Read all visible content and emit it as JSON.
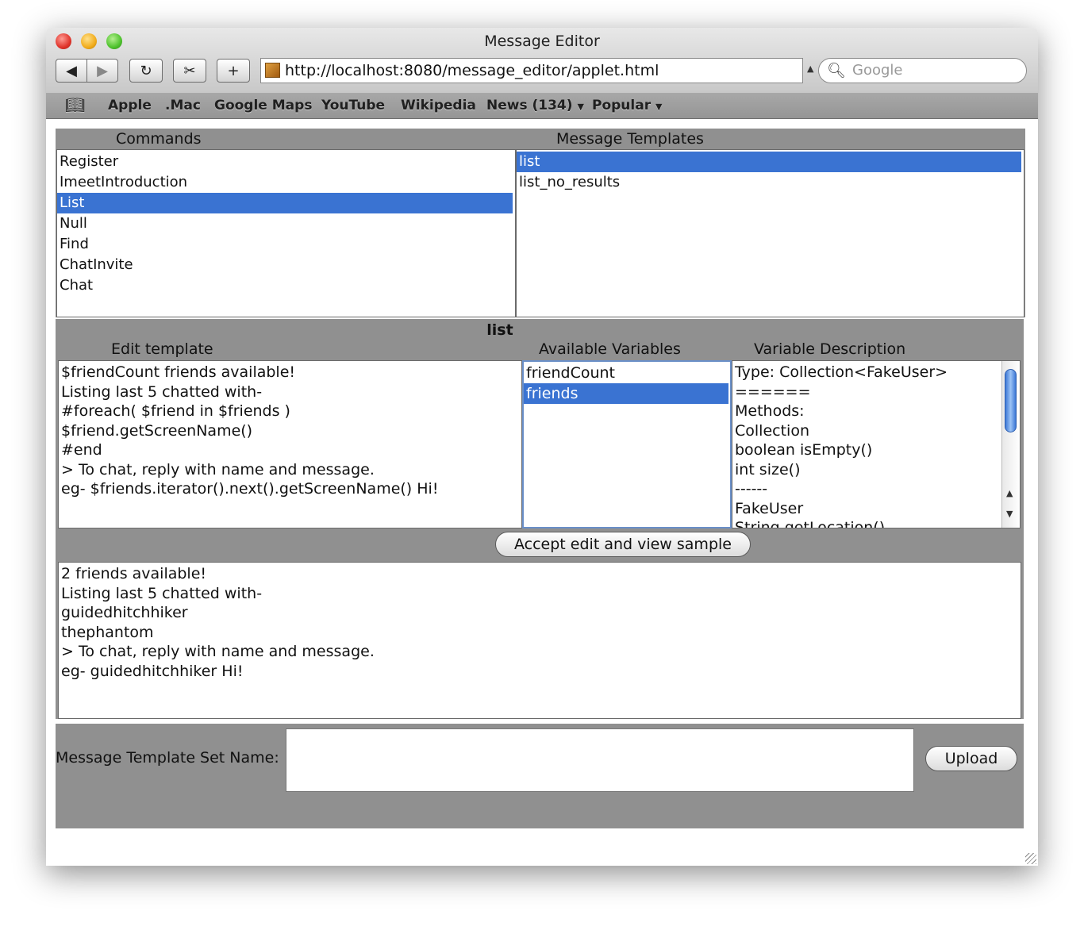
{
  "window": {
    "title": "Message Editor"
  },
  "toolbar": {
    "url": "http://localhost:8080/message_editor/applet.html",
    "search_placeholder": "Google"
  },
  "bookmarks": [
    "Apple",
    ".Mac",
    "Google Maps",
    "YouTube",
    "Wikipedia",
    "News (134)",
    "Popular"
  ],
  "commands": {
    "header": "Commands",
    "items": [
      "Register",
      "ImeetIntroduction",
      "List",
      "Null",
      "Find",
      "ChatInvite",
      "Chat"
    ],
    "selected": "List"
  },
  "templates": {
    "header": "Message Templates",
    "items": [
      "list",
      "list_no_results"
    ],
    "selected": "list"
  },
  "editor": {
    "title": "list",
    "edit_header": "Edit template",
    "vars_header": "Available Variables",
    "desc_header": "Variable Description",
    "template_lines": [
      "$friendCount friends available!",
      "Listing last 5 chatted with-",
      "#foreach( $friend in $friends )",
      "$friend.getScreenName()",
      "#end",
      "> To chat, reply with name and message.",
      "eg- $friends.iterator().next().getScreenName() Hi!"
    ],
    "variables": [
      "friendCount",
      "friends"
    ],
    "selected_variable": "friends",
    "description_lines": [
      "Type: Collection<FakeUser>",
      "======",
      "Methods:",
      "Collection",
      "boolean isEmpty()",
      "int size()",
      "------",
      "FakeUser",
      "String getLocation()"
    ],
    "accept_button": "Accept edit and view sample"
  },
  "sample": {
    "lines": [
      "2 friends available!",
      "Listing last 5 chatted with-",
      "guidedhitchhiker",
      "thephantom",
      "> To chat, reply with name and message.",
      "eg- guidedhitchhiker Hi!"
    ]
  },
  "footer": {
    "set_name_label": "Message Template Set Name:",
    "set_name_value": "",
    "upload_button": "Upload"
  }
}
